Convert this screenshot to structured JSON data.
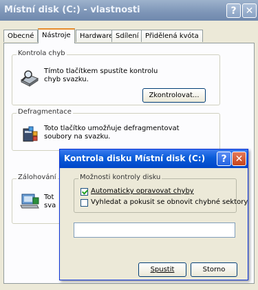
{
  "window": {
    "title": "Místní disk (C:) - vlastnosti",
    "help_glyph": "?",
    "close_glyph": "✕"
  },
  "tabs": [
    {
      "label": "Obecné",
      "active": false
    },
    {
      "label": "Nástroje",
      "active": true
    },
    {
      "label": "Hardware",
      "active": false
    },
    {
      "label": "Sdílení",
      "active": false
    },
    {
      "label": "Přidělená kvóta",
      "active": false
    }
  ],
  "groups": {
    "check": {
      "label": "Kontrola chyb",
      "text": "Tímto tlačítkem spustíte kontrolu chyb svazku.",
      "button": "Zkontrolovat...",
      "icon": "disk-check-icon"
    },
    "defrag": {
      "label": "Defragmentace",
      "text": "Toto tlačítko umožňuje defragmentovat soubory na svazku.",
      "icon": "defrag-icon"
    },
    "backup": {
      "label": "Zálohování",
      "text_line1": "Tot",
      "text_line2": "sva",
      "icon": "backup-icon"
    }
  },
  "dialog": {
    "title": "Kontrola disku Místní disk (C:)",
    "group_label": "Možnosti kontroly disku",
    "option1": {
      "label": "Automaticky opravovat chyby",
      "checked": true
    },
    "option2": {
      "label": "Vyhledat a pokusit se obnovit chybné sektory",
      "checked": false
    },
    "progress": 0,
    "start_button": "Spustit",
    "cancel_button": "Storno"
  },
  "colors": {
    "dialog_title": "#0a5cd8",
    "inactive_title": "#7d95b7",
    "accent_tab": "#e68b2c"
  }
}
